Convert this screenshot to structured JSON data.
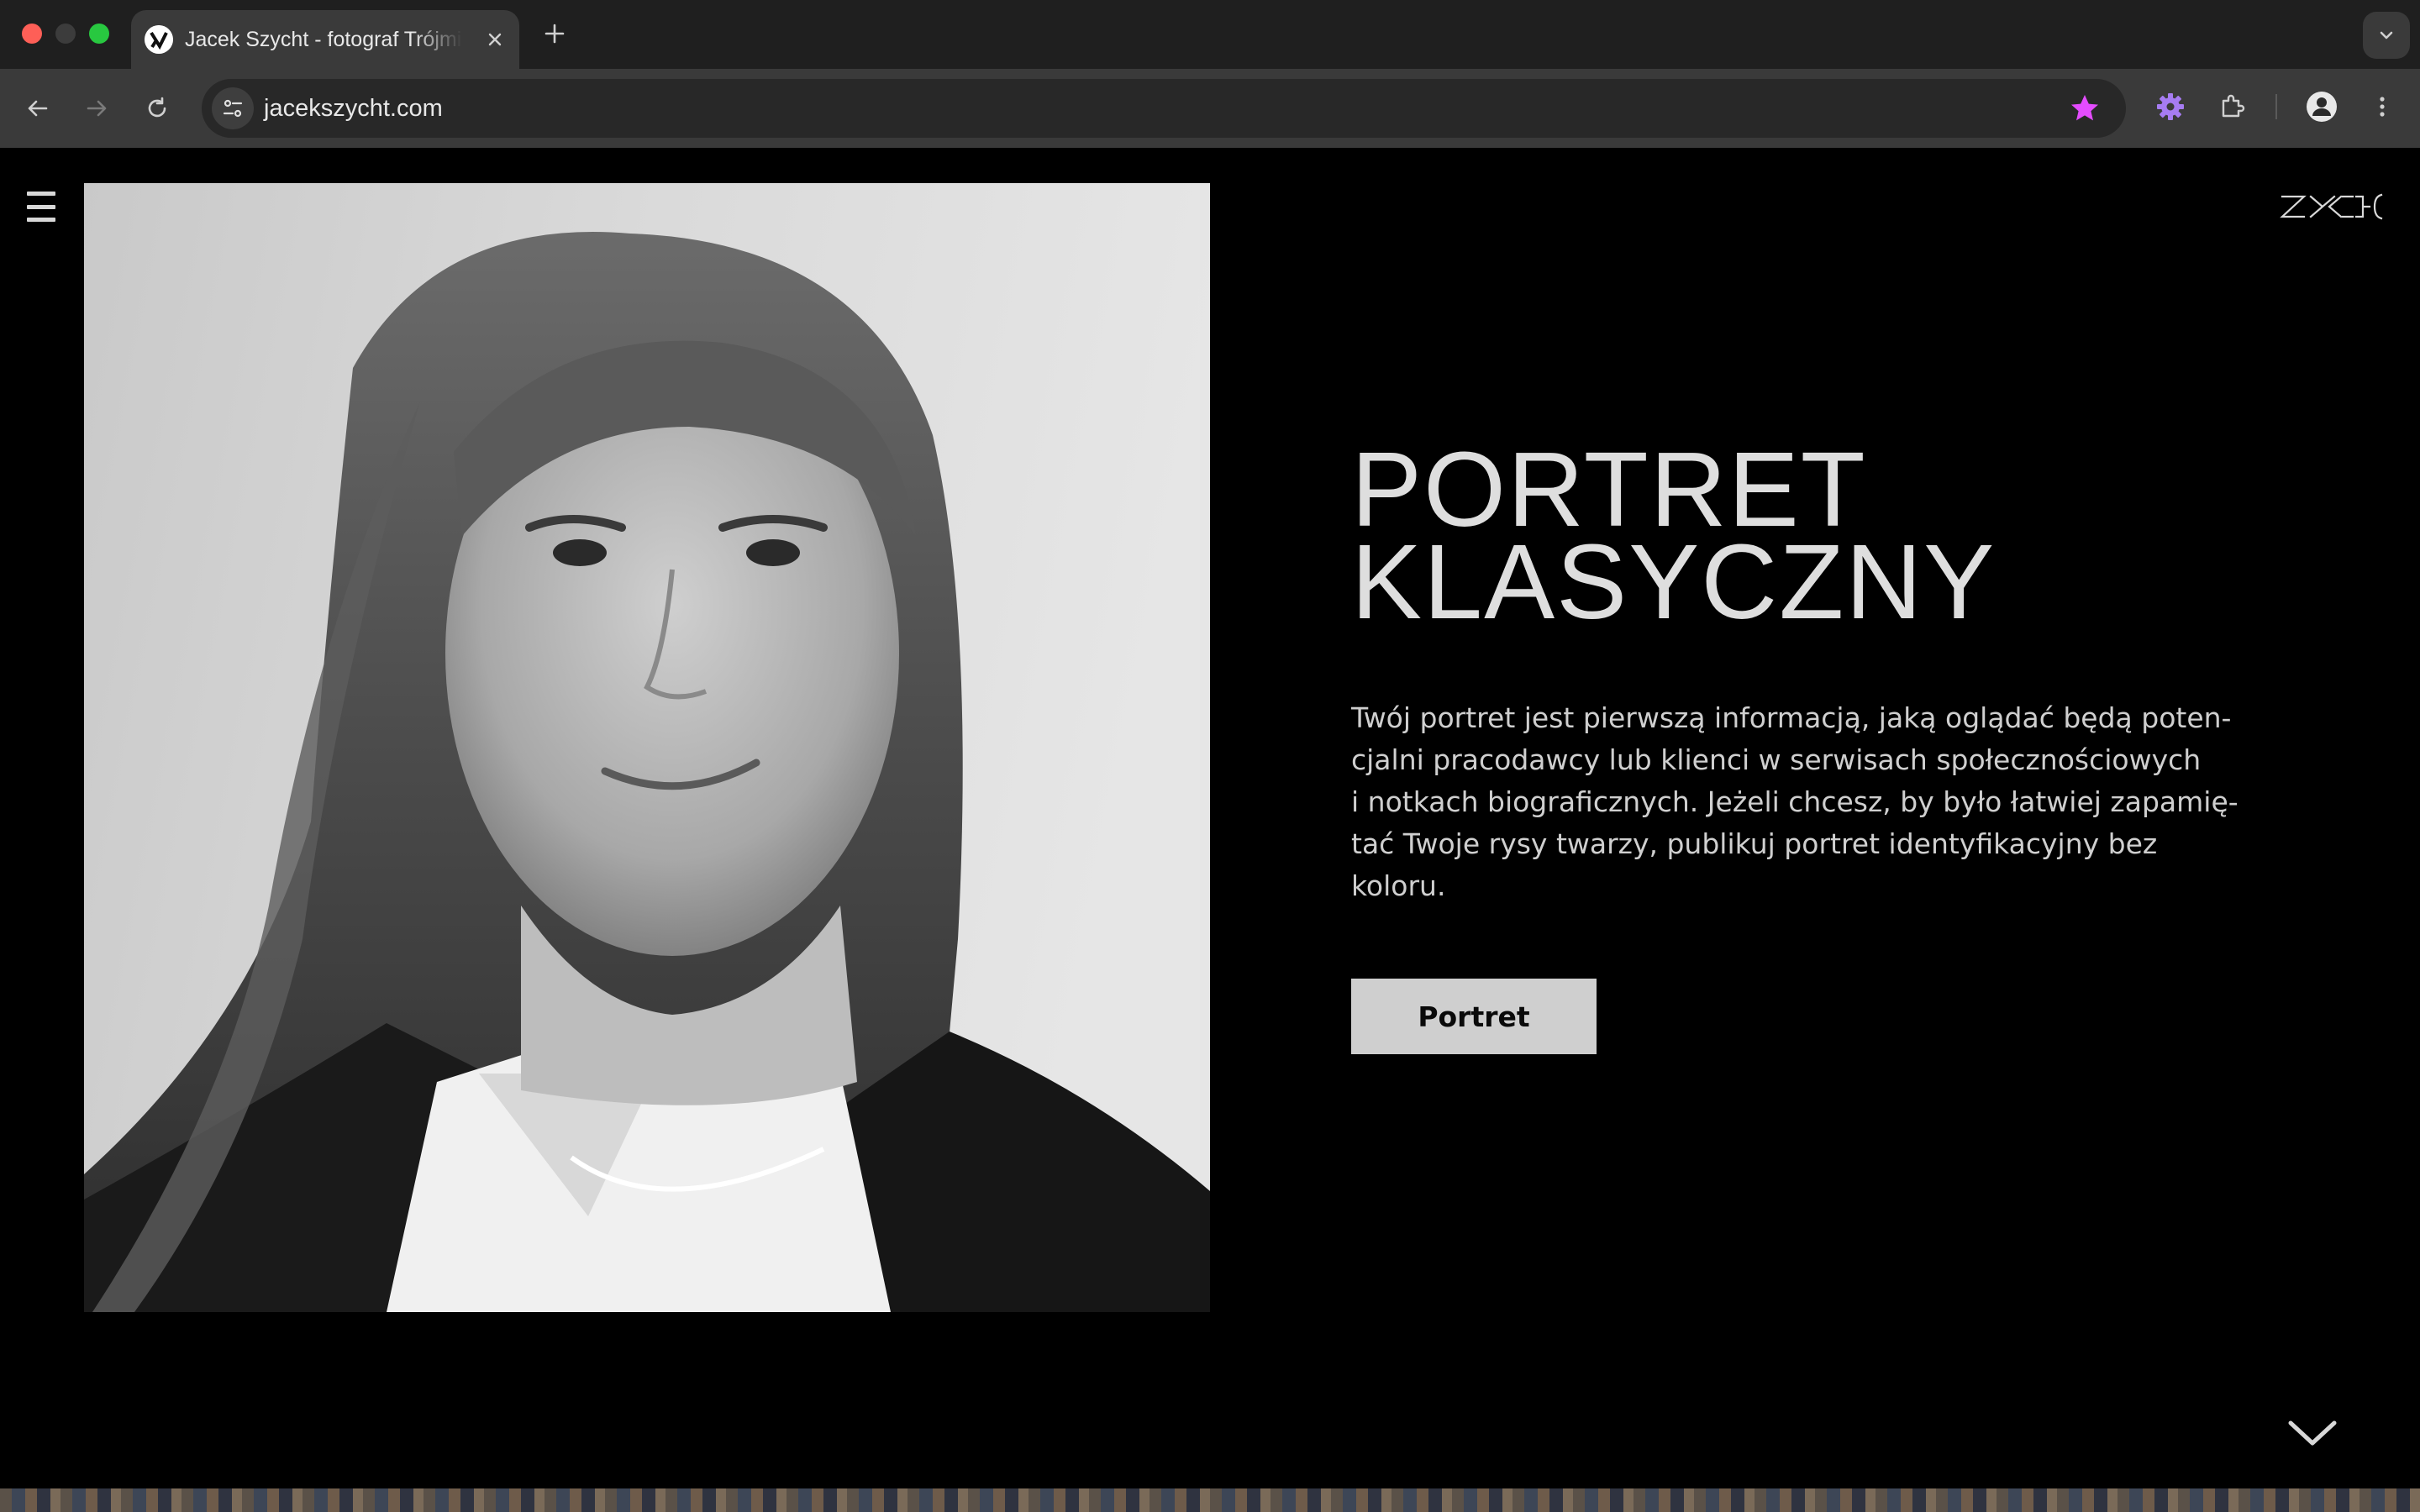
{
  "browser": {
    "tab_title": "Jacek Szycht - fotograf Trójmiasto",
    "url": "jacekszycht.com",
    "bookmark_color": "#e44cff",
    "extension_color": "#a67cf2"
  },
  "site": {
    "logo_text": "SZYCHT",
    "menu_icon": "hamburger-icon",
    "hero": {
      "title_lines": [
        "PORTRET",
        "KLASYCZNY"
      ],
      "paragraph_lines": [
        "Twój portret jest pierwszą informacją, jaką oglądać będą poten-",
        "cjalni pracodawcy lub klienci w serwisach społecznościowych",
        "i notkach biograficznych. Jeżeli chcesz, by było łatwiej zapamię-",
        "tać Twoje rysy twarzy, publikuj portret identyfikacyjny bez",
        "koloru."
      ],
      "button_label": "Portret",
      "photo_alt": "Black and white portrait of a woman with long hair, dark blazer and white shirt"
    },
    "scroll_icon": "chevron-down-icon"
  }
}
